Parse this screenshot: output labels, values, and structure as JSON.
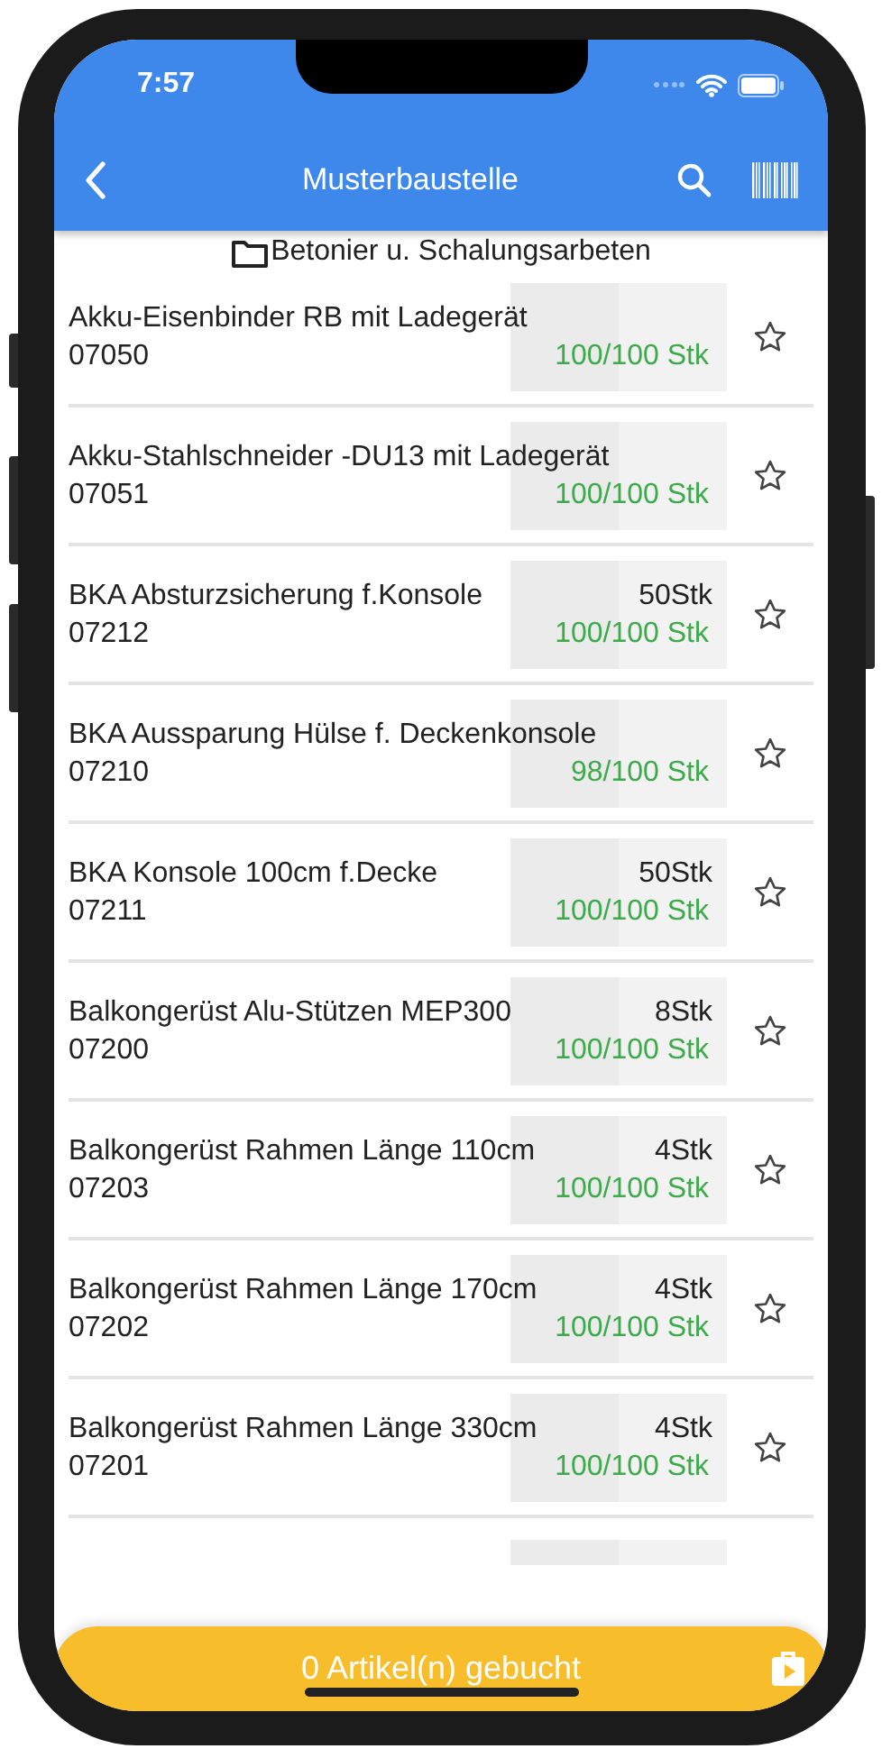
{
  "status_bar": {
    "time": "7:57"
  },
  "app_bar": {
    "title": "Musterbaustelle"
  },
  "category": {
    "label": "Betonier u. Schalungsarbeten"
  },
  "items": [
    {
      "name": "Akku-Eisenbinder RB mit Ladegerät",
      "number": "07050",
      "stock": "100/100 Stk",
      "favorite": false
    },
    {
      "name": "Akku-Stahlschneider -DU13 mit Ladegerät",
      "number": "07051",
      "stock": "100/100 Stk",
      "favorite": false
    },
    {
      "name": "BKA Absturzsicherung f.Konsole",
      "quantity": "50Stk",
      "number": "07212",
      "stock": "100/100 Stk",
      "favorite": false
    },
    {
      "name": "BKA Aussparung Hülse f. Deckenkonsole",
      "number": "07210",
      "stock": "98/100 Stk",
      "favorite": false
    },
    {
      "name": "BKA Konsole 100cm f.Decke",
      "quantity": "50Stk",
      "number": "07211",
      "stock": "100/100 Stk",
      "favorite": false
    },
    {
      "name": "Balkongerüst Alu-Stützen MEP300",
      "quantity": "8Stk",
      "number": "07200",
      "stock": "100/100 Stk",
      "favorite": false
    },
    {
      "name": "Balkongerüst Rahmen Länge 110cm",
      "quantity": "4Stk",
      "number": "07203",
      "stock": "100/100 Stk",
      "favorite": false
    },
    {
      "name": "Balkongerüst Rahmen Länge 170cm",
      "quantity": "4Stk",
      "number": "07202",
      "stock": "100/100 Stk",
      "favorite": false
    },
    {
      "name": "Balkongerüst Rahmen Länge 330cm",
      "quantity": "4Stk",
      "number": "07201",
      "stock": "100/100 Stk",
      "favorite": false
    }
  ],
  "bottom_bar": {
    "label": "0 Artikel(n) gebucht"
  }
}
